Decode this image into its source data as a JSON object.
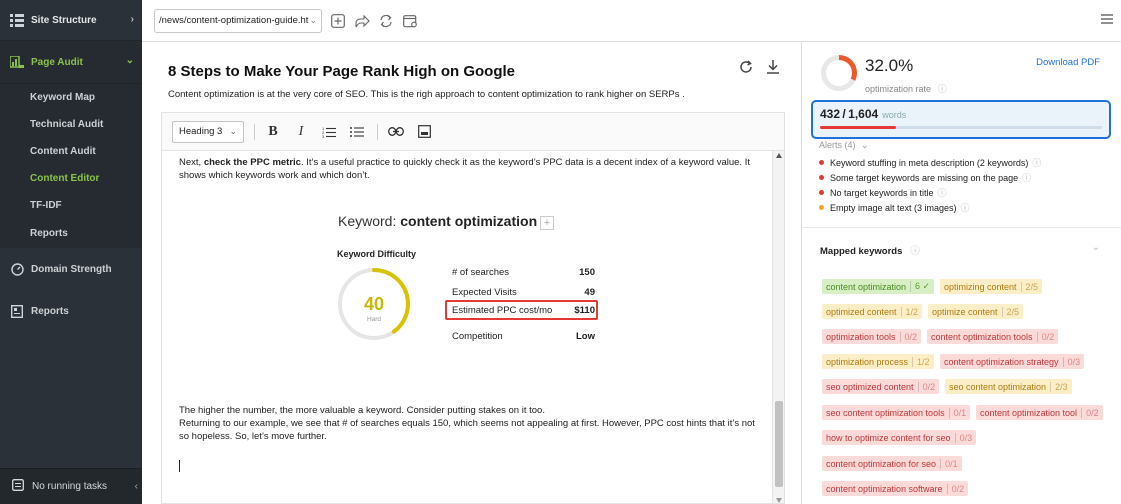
{
  "sidebar": {
    "site_structure": "Site Structure",
    "page_audit": "Page Audit",
    "sub_items": [
      {
        "label": "Keyword Map",
        "active": false
      },
      {
        "label": "Technical Audit",
        "active": false
      },
      {
        "label": "Content Audit",
        "active": false
      },
      {
        "label": "Content Editor",
        "active": true
      },
      {
        "label": "TF-IDF",
        "active": false
      },
      {
        "label": "Reports",
        "active": false
      }
    ],
    "domain_strength": "Domain Strength",
    "reports": "Reports",
    "footer": "No running tasks"
  },
  "topbar": {
    "url": "/news/content-optimization-guide.html"
  },
  "main": {
    "title": "8 Steps to Make Your Page Rank High on Google",
    "description": "Content optimization is at the very core of SEO. This is the righ approach to content optimization to rank higher on SERPs .",
    "heading_select": "Heading 3",
    "para1_prefix": "Next, ",
    "para1_bold": "check the PPC metric",
    "para1_rest": ". It’s a useful practice to quickly check it as the keyword’s PPC data is a decent index of a keyword value. It shows which keywords work and which don’t.",
    "para2_line1": "The higher the number, the more valuable a keyword. Consider putting stakes on it too.",
    "para2_line2": "Returning to our example, we see that # of searches equals 150, which seems not appealing at first. However, PPC cost hints that it’s not so hopeless. So, let’s move further."
  },
  "keyword_card": {
    "prefix": "Keyword:",
    "keyword": "content optimization",
    "difficulty_label": "Keyword Difficulty",
    "difficulty_value": "40",
    "difficulty_level": "Hard",
    "difficulty_fraction": 0.4,
    "metrics": [
      {
        "label": "# of searches",
        "value": "150"
      },
      {
        "label": "Expected Visits",
        "value": "49"
      },
      {
        "label": "Estimated PPC cost/mo",
        "value": "$110"
      },
      {
        "label": "Competition",
        "value": "Low"
      }
    ]
  },
  "right": {
    "rate_value": "32.0%",
    "rate_label": "optimization rate",
    "rate_fraction": 0.32,
    "download_pdf": "Download PDF",
    "words_count": "432 / 1,604",
    "words_label": "words",
    "words_fraction": 0.269,
    "alerts_header": "Alerts (4)",
    "alerts": [
      {
        "text": "Keyword stuffing in meta description (2 keywords)",
        "color": "#e53935"
      },
      {
        "text": "Some target keywords are missing on the page",
        "color": "#e53935"
      },
      {
        "text": "No target keywords in title",
        "color": "#e53935"
      },
      {
        "text": "Empty image alt text (3 images)",
        "color": "#f5a623"
      }
    ],
    "mapped_title": "Mapped keywords",
    "chips": [
      {
        "label": "content optimization",
        "score": "6 ✓",
        "color": "green"
      },
      {
        "label": "optimizing content",
        "score": "2/5",
        "color": "yellow"
      },
      {
        "label": "optimized content",
        "score": "1/2",
        "color": "yellow"
      },
      {
        "label": "optimize content",
        "score": "2/5",
        "color": "yellow"
      },
      {
        "label": "optimization tools",
        "score": "0/2",
        "color": "red"
      },
      {
        "label": "content optimization tools",
        "score": "0/2",
        "color": "red"
      },
      {
        "label": "optimization process",
        "score": "1/2",
        "color": "yellow"
      },
      {
        "label": "content optimization strategy",
        "score": "0/3",
        "color": "red"
      },
      {
        "label": "seo optimized content",
        "score": "0/2",
        "color": "red"
      },
      {
        "label": "seo content optimization",
        "score": "2/3",
        "color": "yellow"
      },
      {
        "label": "seo content optimization tools",
        "score": "0/1",
        "color": "red"
      },
      {
        "label": "content optimization tool",
        "score": "0/2",
        "color": "red"
      },
      {
        "label": "how to optimize content for seo",
        "score": "0/3",
        "color": "red"
      },
      {
        "label": "content optimization for seo",
        "score": "0/1",
        "color": "red"
      },
      {
        "label": "content optimization software",
        "score": "0/2",
        "color": "red"
      }
    ]
  }
}
